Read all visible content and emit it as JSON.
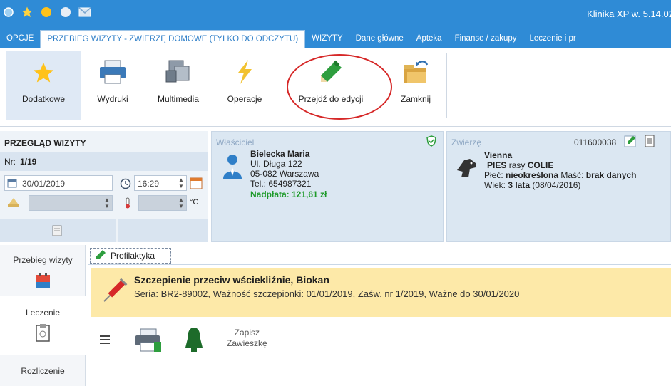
{
  "window": {
    "title": "Klinika XP w. 5.14.02"
  },
  "tabs": [
    {
      "label": "OPCJE"
    },
    {
      "label": "PRZEBIEG WIZYTY - ZWIERZĘ DOMOWE (TYLKO DO ODCZYTU)"
    },
    {
      "label": "WIZYTY"
    },
    {
      "label": "Dane główne"
    },
    {
      "label": "Apteka"
    },
    {
      "label": "Finanse / zakupy"
    },
    {
      "label": "Leczenie i pr"
    }
  ],
  "ribbon": {
    "buttons": [
      {
        "label": "Dodatkowe",
        "icon": "star-icon"
      },
      {
        "label": "Wydruki",
        "icon": "printer-icon"
      },
      {
        "label": "Multimedia",
        "icon": "multimedia-icon"
      },
      {
        "label": "Operacje",
        "icon": "lightning-icon"
      },
      {
        "label": "Przejdź do edycji",
        "icon": "pencil-icon"
      },
      {
        "label": "Zamknij",
        "icon": "close-folder-icon"
      }
    ],
    "highlight_color": "#d62828"
  },
  "visit": {
    "title": "PRZEGLĄD WIZYTY",
    "nr_label": "Nr:",
    "nr_value": "1/19",
    "date": "30/01/2019",
    "time": "16:29",
    "temp_unit": "°C"
  },
  "owner": {
    "title": "Właściciel",
    "name": "Bielecka Maria",
    "street": "Ul. Długa 122",
    "city": "05-082  Warszawa",
    "phone": "Tel.: 654987321",
    "balance": "Nadpłata: 121,61 zł"
  },
  "pet": {
    "title": "Zwierzę",
    "id": "011600038",
    "name": "Vienna",
    "species": "PIES",
    "breed_label": "rasy",
    "breed": "COLIE",
    "sex_label": "Płeć:",
    "sex": "nieokreślona",
    "coat_label": "Maść:",
    "coat": "brak danych",
    "age_label": "Wiek:",
    "age": "3 lata",
    "birth": "(08/04/2016)"
  },
  "leftnav": [
    {
      "label": "Przebieg wizyty"
    },
    {
      "label": "Leczenie"
    },
    {
      "label": "Rozliczenie"
    }
  ],
  "document_tab": {
    "label": "Profilaktyka"
  },
  "vaccination": {
    "title": "Szczepienie przeciw wściekliźnie, Biokan",
    "details": "Seria: BR2-89002, Ważność szczepionki: 01/01/2019, Zaśw. nr 1/2019, Ważne do 30/01/2020"
  },
  "actions": {
    "save_line1": "Zapisz",
    "save_line2": "Zawieszkę"
  },
  "colors": {
    "accent": "#2f8bd6",
    "highlight": "#fde9a8",
    "balance": "#1e9a2a"
  }
}
